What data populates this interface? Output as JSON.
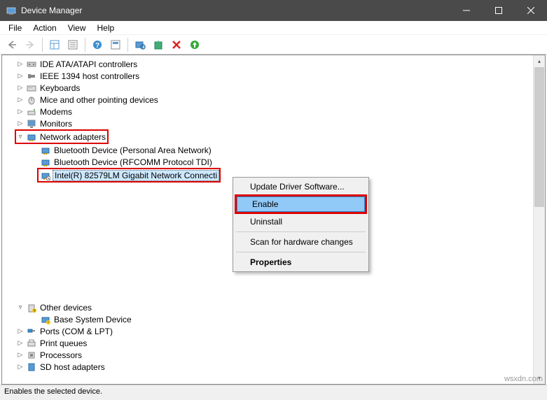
{
  "window": {
    "title": "Device Manager"
  },
  "menu": {
    "file": "File",
    "action": "Action",
    "view": "View",
    "help": "Help"
  },
  "tree": {
    "ide": "IDE ATA/ATAPI controllers",
    "ieee": "IEEE 1394 host controllers",
    "keyboards": "Keyboards",
    "mice": "Mice and other pointing devices",
    "modems": "Modems",
    "monitors": "Monitors",
    "network": "Network adapters",
    "bt1": "Bluetooth Device (Personal Area Network)",
    "bt2": "Bluetooth Device (RFCOMM Protocol TDI)",
    "intel": "Intel(R) 82579LM Gigabit Network Connecti",
    "other": "Other devices",
    "base": "Base System Device",
    "ports": "Ports (COM & LPT)",
    "printq": "Print queues",
    "processors": "Processors",
    "sdhost": "SD host adapters"
  },
  "context": {
    "update": "Update Driver Software...",
    "enable": "Enable",
    "uninstall": "Uninstall",
    "scan": "Scan for hardware changes",
    "properties": "Properties"
  },
  "status": "Enables the selected device.",
  "watermark": "wsxdn.com"
}
